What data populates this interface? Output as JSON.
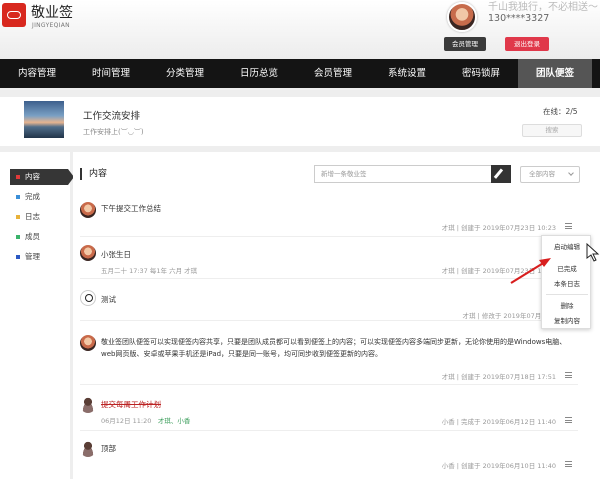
{
  "app": {
    "title": "敬业签",
    "subtitle": "JINGYEQIAN"
  },
  "user": {
    "motto": "千山我独行，不必相送～",
    "phone": "130****3327",
    "member_btn": "会员管理",
    "logout_btn": "退出登录"
  },
  "nav": [
    "内容管理",
    "时间管理",
    "分类管理",
    "日历总览",
    "会员管理",
    "系统设置",
    "密码锁屏",
    "团队便签"
  ],
  "team": {
    "name": "工作交流安排",
    "desc": "工作安排上(︶◡︶)",
    "online": "在线：2/5",
    "search": "搜索"
  },
  "sidebar": [
    {
      "label": "内容",
      "color": "#e03a3a"
    },
    {
      "label": "完成",
      "color": "#3b8fd8"
    },
    {
      "label": "日志",
      "color": "#e8b23a"
    },
    {
      "label": "成员",
      "color": "#3ab36a"
    },
    {
      "label": "管理",
      "color": "#2b59c3"
    }
  ],
  "content": {
    "title": "内容",
    "new_placeholder": "新增一条敬业签",
    "filter": "全部内容"
  },
  "notes": [
    {
      "text": "下午提交工作总结",
      "meta": "",
      "footer": "才琪 | 创建于 2019年07月23日 10:23"
    },
    {
      "text": "小张生日",
      "meta": "五月二十 17:37 每1年 六月 才琪",
      "footer": "才琪 | 创建于 2019年07月23日 10:21"
    },
    {
      "text": "测试",
      "meta": "",
      "footer": "才琪 | 修改于 2019年07月01日"
    },
    {
      "text": "敬业签团队便签可以实现便签内容共享，只要是团队成员都可以看到便签上的内容；可以实现便签内容多端同步更新，无论你使用的是Windows电脑、web网页版、安卓或苹果手机还是iPad，只要是同一账号，均可同步收到便签更新的内容。",
      "meta": "",
      "footer": "才琪 | 创建于 2019年07月18日 17:51"
    },
    {
      "text": "提交每周工作计划",
      "meta_a": "06月12日 11:20",
      "meta_b": "才琪、小香",
      "footer": "小香 | 完成于 2019年06月12日 11:40"
    },
    {
      "text": "顶部",
      "meta": "",
      "footer": "小香 | 创建于 2019年06月10日 11:40"
    }
  ],
  "popup": [
    "启动编辑",
    "已完成",
    "本条日志",
    "删除",
    "复制内容"
  ],
  "colors": {
    "accent": "#d8281e",
    "nav_bg": "#141414",
    "logout": "#e0384a"
  }
}
